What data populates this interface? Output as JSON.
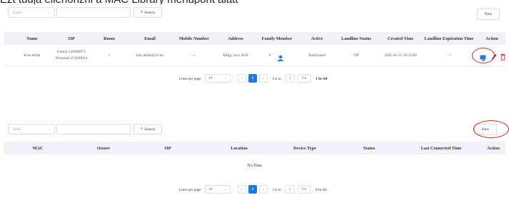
{
  "caption": "Ezt tudja ellenőrizni a MAC Library menüpont alatt",
  "panel1": {
    "filter_select": "Name",
    "search_label": "Search",
    "new_label": "New",
    "columns": [
      "Name",
      "SIP",
      "Room",
      "Email",
      "Mobile Number",
      "Address",
      "Family Member",
      "Active",
      "Landline Status",
      "Created Time",
      "Landline Expiration Time",
      "Action"
    ],
    "row": {
      "name": "Kiss Attila",
      "sip_family": "Family:119000071",
      "sip_personal": "Personal:119100634",
      "room": "1",
      "email": "kiss.attila@yli.hu",
      "mobile": "--",
      "address": "Ibligy utca 30 B",
      "family_member": "0",
      "active": "Inactivated",
      "landline_status": "Off",
      "created_time": "2021-02-11 10:33:00",
      "landline_expiration": "--"
    },
    "pagination": {
      "lines_per_page_label": "Lines per page",
      "lines_per_page": "10",
      "current_page": "1",
      "goto_label": "Go to",
      "goto_value": "1",
      "go_label": "Go",
      "total": "1 In All"
    }
  },
  "panel2": {
    "filter_select": "MAC",
    "search_label": "Search",
    "new_label": "New",
    "columns": [
      "MAC",
      "Owner",
      "SIP",
      "Location",
      "Device Type",
      "Status",
      "Last Connected Time",
      "Action"
    ],
    "empty_text": "No Data",
    "pagination": {
      "lines_per_page_label": "Lines per page",
      "lines_per_page": "10",
      "current_page": "1",
      "goto_label": "Go to",
      "goto_value": "1",
      "go_label": "Go",
      "total": "0 In All"
    }
  },
  "colors": {
    "accent": "#1f7ad9",
    "delete": "#e03c3c",
    "highlight_oval": "#d9261c"
  }
}
